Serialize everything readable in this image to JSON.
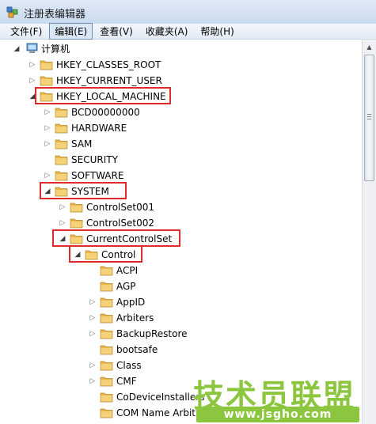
{
  "window": {
    "title": "注册表编辑器"
  },
  "menu": [
    {
      "label": "文件(F)"
    },
    {
      "label": "编辑(E)"
    },
    {
      "label": "查看(V)"
    },
    {
      "label": "收藏夹(A)"
    },
    {
      "label": "帮助(H)"
    }
  ],
  "tree": [
    {
      "label": "计算机",
      "expanded": true,
      "icon": "computer-icon"
    },
    {
      "label": "HKEY_CLASSES_ROOT",
      "expanded": false,
      "icon": "folder-icon"
    },
    {
      "label": "HKEY_CURRENT_USER",
      "expanded": false,
      "icon": "folder-icon"
    },
    {
      "label": "HKEY_LOCAL_MACHINE",
      "expanded": true,
      "icon": "folder-icon",
      "highlighted": true
    },
    {
      "label": "BCD00000000",
      "expanded": false,
      "icon": "folder-icon"
    },
    {
      "label": "HARDWARE",
      "expanded": false,
      "icon": "folder-icon"
    },
    {
      "label": "SAM",
      "expanded": false,
      "icon": "folder-icon"
    },
    {
      "label": "SECURITY",
      "expanded": false,
      "icon": "folder-icon"
    },
    {
      "label": "SOFTWARE",
      "expanded": false,
      "icon": "folder-icon"
    },
    {
      "label": "SYSTEM",
      "expanded": true,
      "icon": "folder-icon",
      "highlighted": true
    },
    {
      "label": "ControlSet001",
      "expanded": false,
      "icon": "folder-icon"
    },
    {
      "label": "ControlSet002",
      "expanded": false,
      "icon": "folder-icon"
    },
    {
      "label": "CurrentControlSet",
      "expanded": true,
      "icon": "folder-icon",
      "highlighted": true
    },
    {
      "label": "Control",
      "expanded": true,
      "icon": "folder-icon",
      "highlighted": true
    },
    {
      "label": "ACPI",
      "icon": "folder-icon"
    },
    {
      "label": "AGP",
      "icon": "folder-icon"
    },
    {
      "label": "AppID",
      "expanded": false,
      "icon": "folder-icon"
    },
    {
      "label": "Arbiters",
      "expanded": false,
      "icon": "folder-icon"
    },
    {
      "label": "BackupRestore",
      "expanded": false,
      "icon": "folder-icon"
    },
    {
      "label": "bootsafe",
      "icon": "folder-icon"
    },
    {
      "label": "Class",
      "expanded": false,
      "icon": "folder-icon"
    },
    {
      "label": "CMF",
      "expanded": false,
      "icon": "folder-icon"
    },
    {
      "label": "CoDeviceInstallers",
      "icon": "folder-icon"
    },
    {
      "label": "COM Name Arbit",
      "icon": "folder-icon"
    }
  ],
  "watermark": {
    "name": "技术员联盟",
    "url": "www.jsgho.com"
  },
  "colors": {
    "highlight": "#e02b2b",
    "folder": "#e8b84a",
    "watermark": "#8cc63f"
  }
}
